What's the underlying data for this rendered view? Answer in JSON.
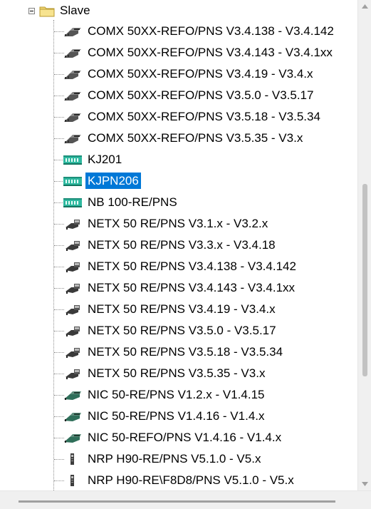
{
  "tree": {
    "parent": {
      "label": "Slave"
    },
    "items": [
      {
        "label": "COMX 50XX-REFO/PNS V3.4.138 - V3.4.142",
        "icon": "comx-module-icon"
      },
      {
        "label": "COMX 50XX-REFO/PNS V3.4.143 - V3.4.1xx",
        "icon": "comx-module-icon"
      },
      {
        "label": "COMX 50XX-REFO/PNS V3.4.19 - V3.4.x",
        "icon": "comx-module-icon"
      },
      {
        "label": "COMX 50XX-REFO/PNS V3.5.0 - V3.5.17",
        "icon": "comx-module-icon"
      },
      {
        "label": "COMX 50XX-REFO/PNS V3.5.18 - V3.5.34",
        "icon": "comx-module-icon"
      },
      {
        "label": "COMX 50XX-REFO/PNS V3.5.35 - V3.x",
        "icon": "comx-module-icon"
      },
      {
        "label": "KJ201",
        "icon": "io-card-icon"
      },
      {
        "label": "KJPN206",
        "icon": "io-card-icon",
        "selected": true
      },
      {
        "label": "NB 100-RE/PNS",
        "icon": "io-card-icon"
      },
      {
        "label": "NETX 50 RE/PNS V3.1.x - V3.2.x",
        "icon": "netx-chip-icon"
      },
      {
        "label": "NETX 50 RE/PNS V3.3.x - V3.4.18",
        "icon": "netx-chip-icon"
      },
      {
        "label": "NETX 50 RE/PNS V3.4.138 - V3.4.142",
        "icon": "netx-chip-icon"
      },
      {
        "label": "NETX 50 RE/PNS V3.4.143 - V3.4.1xx",
        "icon": "netx-chip-icon"
      },
      {
        "label": "NETX 50 RE/PNS V3.4.19 - V3.4.x",
        "icon": "netx-chip-icon"
      },
      {
        "label": "NETX 50 RE/PNS V3.5.0 - V3.5.17",
        "icon": "netx-chip-icon"
      },
      {
        "label": "NETX 50 RE/PNS V3.5.18 - V3.5.34",
        "icon": "netx-chip-icon"
      },
      {
        "label": "NETX 50 RE/PNS V3.5.35 - V3.x",
        "icon": "netx-chip-icon"
      },
      {
        "label": "NIC 50-RE/PNS V1.2.x - V1.4.15",
        "icon": "nic-module-icon"
      },
      {
        "label": "NIC 50-RE/PNS V1.4.16 - V1.4.x",
        "icon": "nic-module-icon"
      },
      {
        "label": "NIC 50-REFO/PNS V1.4.16 - V1.4.x",
        "icon": "nic-module-icon"
      },
      {
        "label": "NRP H90-RE/PNS V5.1.0 - V5.x",
        "icon": "nrp-device-icon"
      },
      {
        "label": "NRP H90-RE\\F8D8/PNS V5.1.0 - V5.x",
        "icon": "nrp-device-icon"
      }
    ]
  },
  "colors": {
    "selection": "#0078d7",
    "card_green": "#2fb9a0"
  }
}
